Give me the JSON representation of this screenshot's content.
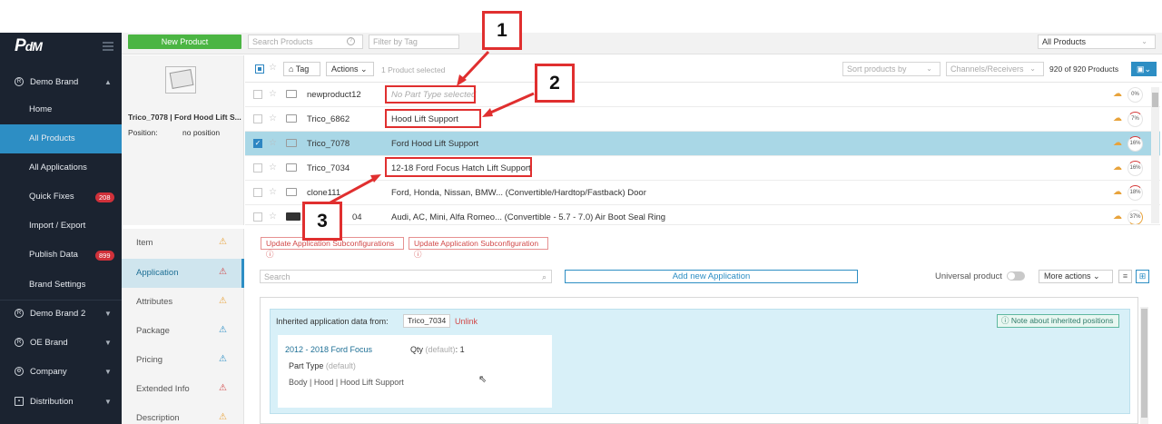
{
  "sidebar": {
    "logo_main": "P",
    "logo_sub": "dM",
    "items": [
      {
        "label": "Demo Brand",
        "icon": "brand-icon",
        "expandable": true
      },
      {
        "label": "Home"
      },
      {
        "label": "All Products",
        "active": true
      },
      {
        "label": "All Applications"
      },
      {
        "label": "Quick Fixes",
        "badge": "208"
      },
      {
        "label": "Import / Export"
      },
      {
        "label": "Publish Data",
        "badge": "899"
      },
      {
        "label": "Brand Settings"
      },
      {
        "label": "Demo Brand 2",
        "icon": "brand-icon",
        "expandable": true
      },
      {
        "label": "OE Brand",
        "icon": "brand-icon",
        "expandable": true
      },
      {
        "label": "Company",
        "icon": "gear-icon",
        "expandable": true
      },
      {
        "label": "Distribution",
        "icon": "distribution-icon",
        "expandable": true
      }
    ]
  },
  "toolbar": {
    "new_product": "New Product",
    "search_placeholder": "Search Products",
    "tag_filter_placeholder": "Filter by Tag",
    "scope_select": "All Products"
  },
  "preview": {
    "title": "Trico_7078 | Ford Hood Lift S...",
    "position_label": "Position:",
    "position_value": "no position"
  },
  "list": {
    "tag_button": "Tag",
    "actions_button": "Actions",
    "selected_info": "1 Product selected",
    "sort_placeholder": "Sort products by",
    "channels_placeholder": "Channels/Receivers",
    "count": "920 of 920 Products",
    "rows": [
      {
        "sku": "newproduct12",
        "part_type": "No Part Type selected",
        "pct": "0%",
        "empty": true
      },
      {
        "sku": "Trico_6862",
        "part_type": "Hood Lift Support",
        "pct": "7%"
      },
      {
        "sku": "Trico_7078",
        "part_type": "Ford Hood Lift Support",
        "pct": "16%",
        "selected": true
      },
      {
        "sku": "Trico_7034",
        "part_type": "12-18 Ford Focus Hatch Lift Support",
        "pct": "16%"
      },
      {
        "sku": "clone111",
        "part_type": "Ford, Honda, Nissan, BMW... (Convertible/Hardtop/Fastback) Door",
        "pct": "18%"
      },
      {
        "sku": "04",
        "part_type": "Audi, AC, Mini, Alfa Romeo... (Convertible - 5.7 - 7.0) Air Boot Seal Ring",
        "pct": "37%"
      }
    ]
  },
  "tabs": [
    {
      "label": "Item",
      "warn": "warning-icon-orange"
    },
    {
      "label": "Application",
      "warn": "warning-icon-red",
      "active": true
    },
    {
      "label": "Attributes",
      "warn": "warning-icon-orange"
    },
    {
      "label": "Package",
      "warn": "warning-icon-blue"
    },
    {
      "label": "Pricing",
      "warn": "warning-icon-blue"
    },
    {
      "label": "Extended Info",
      "warn": "warning-icon-red"
    },
    {
      "label": "Description",
      "warn": "warning-icon-orange"
    }
  ],
  "application": {
    "update_btn_1": "Update Application Subconfigurations",
    "update_btn_2": "Update Application Subconfiguration",
    "search_placeholder": "Search",
    "add_new": "Add new Application",
    "universal_label": "Universal product",
    "more_actions": "More actions",
    "inherited_label": "Inherited application data from:",
    "inherited_from": "Trico_7034",
    "unlink": "Unlink",
    "note": "Note about inherited positions",
    "vehicle": "2012 - 2018 Ford Focus",
    "qty_label": "Qty",
    "qty_default": "(default)",
    "qty_value": ": 1",
    "part_type_label": "Part Type",
    "part_type_default": "(default)",
    "part_type_value": "Body | Hood | Hood Lift Support"
  },
  "callouts": [
    "1",
    "2",
    "3"
  ],
  "colors": {
    "accent": "#2d8ec4",
    "sidebar": "#1b2330",
    "green": "#4bb543",
    "callout": "#e02f2f"
  }
}
